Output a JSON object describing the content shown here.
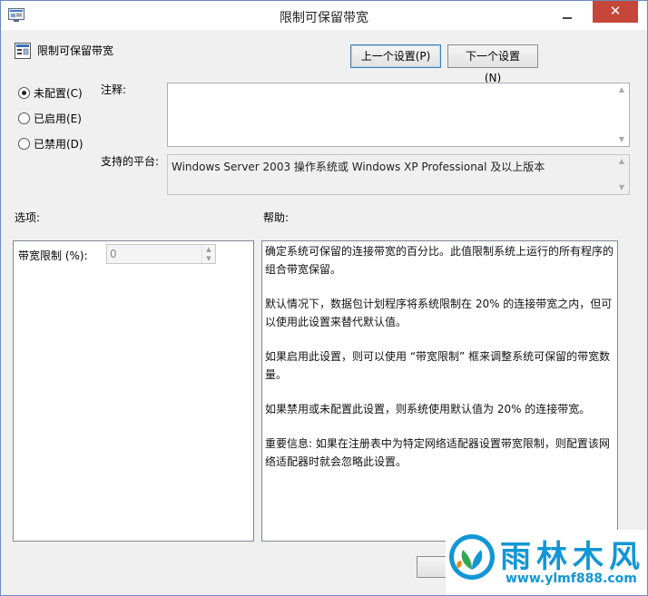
{
  "window": {
    "title": "限制可保留带宽",
    "close_glyph": "✕"
  },
  "header": {
    "policy_name": "限制可保留带宽",
    "prev_button": "上一个设置(P)",
    "next_button": "下一个设置(N)"
  },
  "state": {
    "options": [
      {
        "label": "未配置(C)",
        "checked": true
      },
      {
        "label": "已启用(E)",
        "checked": false
      },
      {
        "label": "已禁用(D)",
        "checked": false
      }
    ]
  },
  "comment": {
    "label": "注释:",
    "value": ""
  },
  "platform": {
    "label": "支持的平台:",
    "value": "Windows Server 2003 操作系统或 Windows XP Professional 及以上版本"
  },
  "options_section": {
    "label": "选项:",
    "bandwidth_label": "带宽限制 (%):",
    "bandwidth_value": "0"
  },
  "help_section": {
    "label": "帮助:",
    "paragraphs": [
      "确定系统可保留的连接带宽的百分比。此值限制系统上运行的所有程序的组合带宽保留。",
      "默认情况下，数据包计划程序将系统限制在 20% 的连接带宽之内，但可以使用此设置来替代默认值。",
      "如果启用此设置，则可以使用 “带宽限制” 框来调整系统可保留的带宽数量。",
      "如果禁用或未配置此设置，则系统使用默认值为 20% 的连接带宽。",
      "重要信息: 如果在注册表中为特定网络适配器设置带宽限制，则配置该网络适配器时就会忽略此设置。"
    ]
  },
  "footer": {
    "ok_button": "确"
  },
  "watermark": {
    "title": "雨林木风",
    "url": "www.ylmf888.com"
  },
  "colors": {
    "accent": "#1296d6",
    "close": "#c7463a"
  }
}
